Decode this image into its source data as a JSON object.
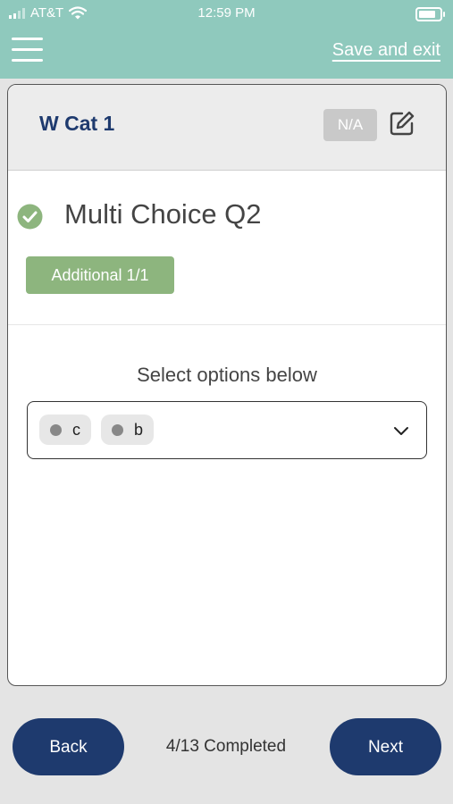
{
  "status_bar": {
    "carrier": "AT&T",
    "time": "12:59 PM",
    "icons": [
      "signal-icon",
      "wifi-icon",
      "battery-icon"
    ]
  },
  "header": {
    "menu_icon": "hamburger-menu-icon",
    "save_exit_label": "Save and exit",
    "background_color": "#8fc9bd"
  },
  "card": {
    "title": "W Cat 1",
    "na_label": "N/A",
    "edit_icon": "edit-icon"
  },
  "question": {
    "status_icon": "check-circle-icon",
    "title": "Multi Choice Q2",
    "additional_label": "Additional 1/1",
    "select_label": "Select options below",
    "selected_options": [
      "c",
      "b"
    ],
    "dropdown_icon": "chevron-down-icon"
  },
  "footer": {
    "back_label": "Back",
    "progress_text": "4/13 Completed",
    "next_label": "Next",
    "button_color": "#1e3a6e"
  }
}
